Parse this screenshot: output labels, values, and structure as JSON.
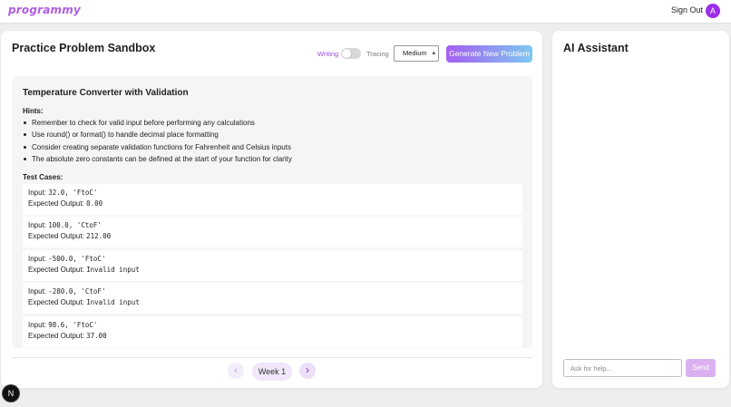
{
  "header": {
    "logo_text": "programmy",
    "sign_out_label": "Sign Out",
    "avatar_initial": "A"
  },
  "sandbox": {
    "title": "Practice Problem Sandbox",
    "mode_toggle": {
      "left_label": "Writing",
      "right_label": "Tracing",
      "active": "Writing"
    },
    "difficulty": {
      "selected": "Medium"
    },
    "generate_label": "Generate New Problem"
  },
  "problem": {
    "title": "Temperature Converter with Validation",
    "hints_heading": "Hints:",
    "hints": [
      "Remember to check for valid input before performing any calculations",
      "Use round() or format() to handle decimal place formatting",
      "Consider creating separate validation functions for Fahrenheit and Celsius inputs",
      "The absolute zero constants can be defined at the start of your function for clarity"
    ],
    "tests_heading": "Test Cases:",
    "input_prefix": "Input:",
    "output_prefix": "Expected Output:",
    "test_cases": [
      {
        "input": "32.0, 'FtoC'",
        "output": "0.00"
      },
      {
        "input": "100.0, 'CtoF'",
        "output": "212.00"
      },
      {
        "input": "-500.0, 'FtoC'",
        "output": "Invalid input"
      },
      {
        "input": "-280.0, 'CtoF'",
        "output": "Invalid input"
      },
      {
        "input": "98.6, 'FtoC'",
        "output": "37.00"
      }
    ]
  },
  "pagination": {
    "prev_icon": "chevron-left-icon",
    "next_icon": "chevron-right-icon",
    "current_label": "Week 1"
  },
  "assistant": {
    "title": "AI Assistant",
    "input_placeholder": "Ask for help...",
    "send_label": "Send"
  },
  "floating": {
    "badge_letter": "N"
  },
  "colors": {
    "accent_purple": "#9b2ee6",
    "gradient_start": "#a45ef0",
    "gradient_end": "#7ec9f0",
    "send_disabled": "#dbb0f0"
  }
}
